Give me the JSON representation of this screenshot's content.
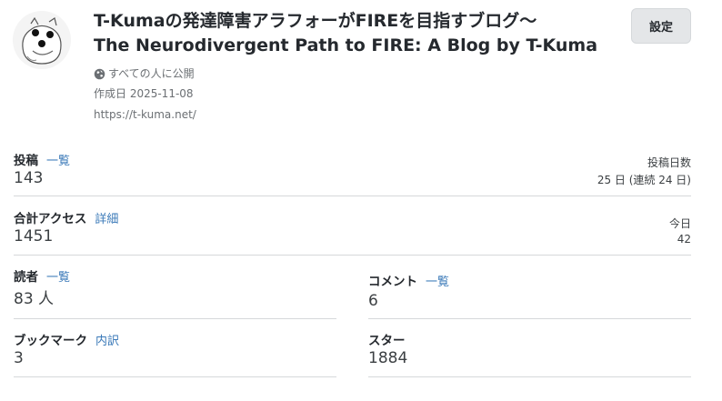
{
  "blog": {
    "title_line1": "T-Kumaの発達障害アラフォーがFIREを目指すブログ〜",
    "title_line2": "The Neurodivergent Path to FIRE: A Blog by T-Kuma",
    "visibility": "すべての人に公開",
    "created": "作成日 2025-11-08",
    "url": "https://t-kuma.net/"
  },
  "header": {
    "settings_label": "設定"
  },
  "stats": {
    "posts": {
      "label": "投稿",
      "link": "一覧",
      "value": "143"
    },
    "post_days": {
      "label": "投稿日数",
      "value": "25 日 (連続 24 日)"
    },
    "access": {
      "label": "合計アクセス",
      "link": "詳細",
      "value": "1451"
    },
    "today": {
      "label": "今日",
      "value": "42"
    },
    "readers": {
      "label": "読者",
      "link": "一覧",
      "value": "83 人"
    },
    "comments": {
      "label": "コメント",
      "link": "一覧",
      "value": "6"
    },
    "bookmarks": {
      "label": "ブックマーク",
      "link": "内訳",
      "value": "3"
    },
    "stars": {
      "label": "スター",
      "value": "1884"
    }
  },
  "icons": {
    "avatar": "cartoon-face-avatar",
    "visibility": "globe-icon"
  }
}
